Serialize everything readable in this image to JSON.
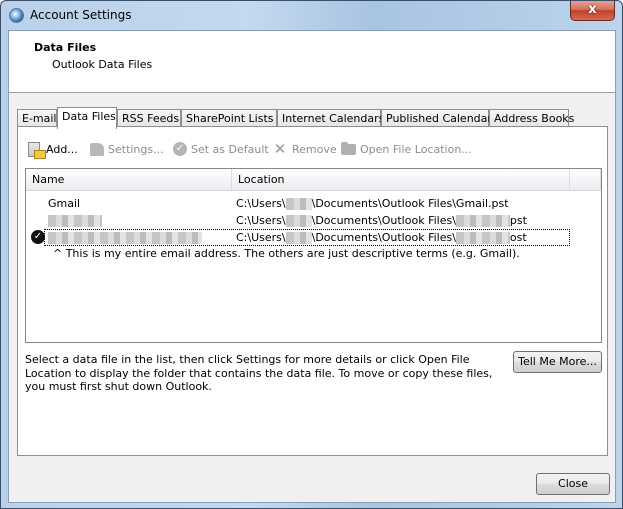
{
  "window": {
    "title": "Account Settings",
    "close_glyph": "x"
  },
  "header": {
    "title": "Data Files",
    "subtitle": "Outlook Data Files"
  },
  "tabs": [
    {
      "label": "E-mail",
      "active": false
    },
    {
      "label": "Data Files",
      "active": true
    },
    {
      "label": "RSS Feeds",
      "active": false
    },
    {
      "label": "SharePoint Lists",
      "active": false
    },
    {
      "label": "Internet Calendars",
      "active": false
    },
    {
      "label": "Published Calendars",
      "active": false
    },
    {
      "label": "Address Books",
      "active": false
    }
  ],
  "toolbar": {
    "add": {
      "label": "Add...",
      "icon": "add-data-file-icon",
      "enabled": true
    },
    "settings": {
      "label": "Settings...",
      "icon": "settings-icon",
      "enabled": false
    },
    "set_default": {
      "label": "Set as Default",
      "icon": "check-circle-icon",
      "enabled": false
    },
    "remove": {
      "label": "Remove",
      "icon": "remove-x-icon",
      "enabled": false
    },
    "open_location": {
      "label": "Open File Location...",
      "icon": "folder-icon",
      "enabled": false
    }
  },
  "list": {
    "columns": [
      "Name",
      "Location"
    ],
    "rows": [
      {
        "name": "Gmail",
        "loc_prefix": "C:\\Users\\",
        "loc_mid": "\\Documents\\Outlook Files\\",
        "loc_suffix": "Gmail.pst",
        "name_redacted": false,
        "file_redacted": false,
        "default": false,
        "selected": false
      },
      {
        "name": "",
        "loc_prefix": "C:\\Users\\",
        "loc_mid": "\\Documents\\Outlook Files\\",
        "loc_suffix": "pst",
        "name_redacted": true,
        "file_redacted": true,
        "default": false,
        "selected": false
      },
      {
        "name": "",
        "loc_prefix": "C:\\Users\\",
        "loc_mid": "\\Documents\\Outlook Files\\",
        "loc_suffix": "ost",
        "name_redacted": true,
        "file_redacted": true,
        "default": true,
        "selected": true
      }
    ],
    "annotation": "^ This is my entire email address. The others are just descriptive terms (e.g. Gmail)."
  },
  "help_text": "Select a data file in the list, then click Settings for more details or click Open File Location to display the folder that contains the data file. To move or copy these files, you must first shut down Outlook.",
  "buttons": {
    "tell_me_more": "Tell Me More...",
    "close": "Close"
  }
}
